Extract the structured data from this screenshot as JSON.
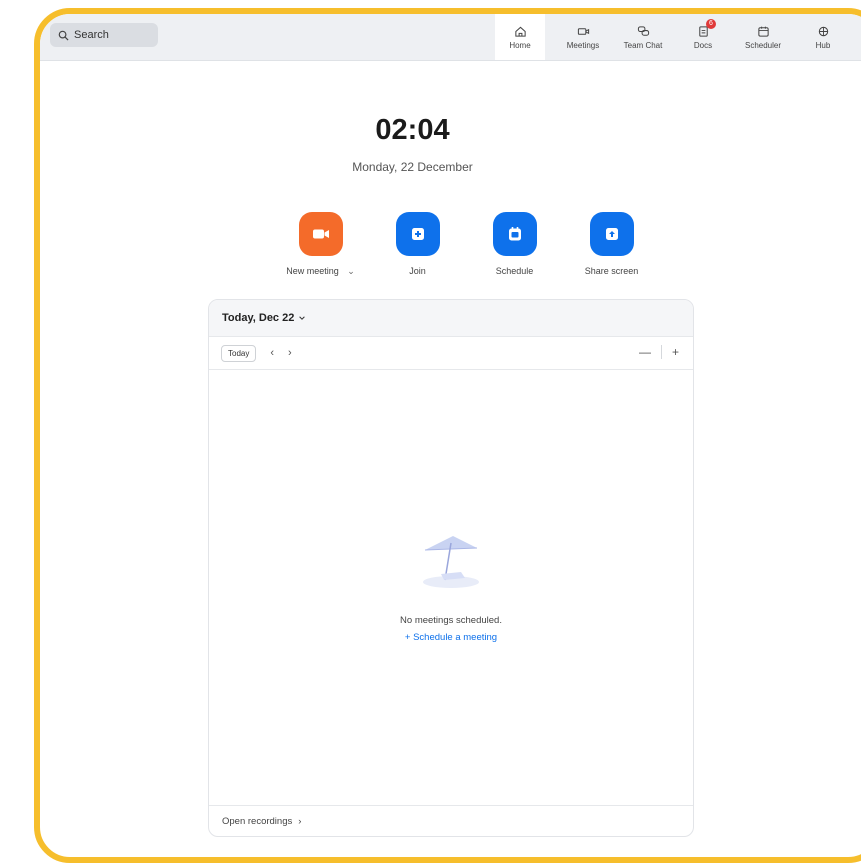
{
  "search": {
    "label": "Search"
  },
  "nav": [
    {
      "label": "Home",
      "icon": "home-icon"
    },
    {
      "label": "Meetings",
      "icon": "video-icon"
    },
    {
      "label": "Team Chat",
      "icon": "chat-icon"
    },
    {
      "label": "Docs",
      "icon": "docs-icon",
      "badge": "6"
    },
    {
      "label": "Scheduler",
      "icon": "calendar-icon"
    },
    {
      "label": "Hub",
      "icon": "hub-icon"
    }
  ],
  "clock": {
    "time": "02:04",
    "date": "Monday, 22 December"
  },
  "actions": [
    {
      "label": "New meeting",
      "caret": "⌄",
      "color": "#f46b2a"
    },
    {
      "label": "Join",
      "color": "#0e71eb"
    },
    {
      "label": "Schedule",
      "color": "#0e71eb"
    },
    {
      "label": "Share screen",
      "color": "#0e71eb"
    }
  ],
  "calendar": {
    "header": "Today, Dec 22",
    "today_button": "Today",
    "prev": "‹",
    "next": "›",
    "zoom_out": "—",
    "zoom_in": "+",
    "empty_text": "No meetings scheduled.",
    "schedule_link": "+ Schedule a meeting",
    "footer": "Open recordings",
    "footer_arrow": "›"
  },
  "colors": {
    "accent": "#0e71eb",
    "orange": "#f46b2a",
    "frame": "#f6be2c"
  }
}
